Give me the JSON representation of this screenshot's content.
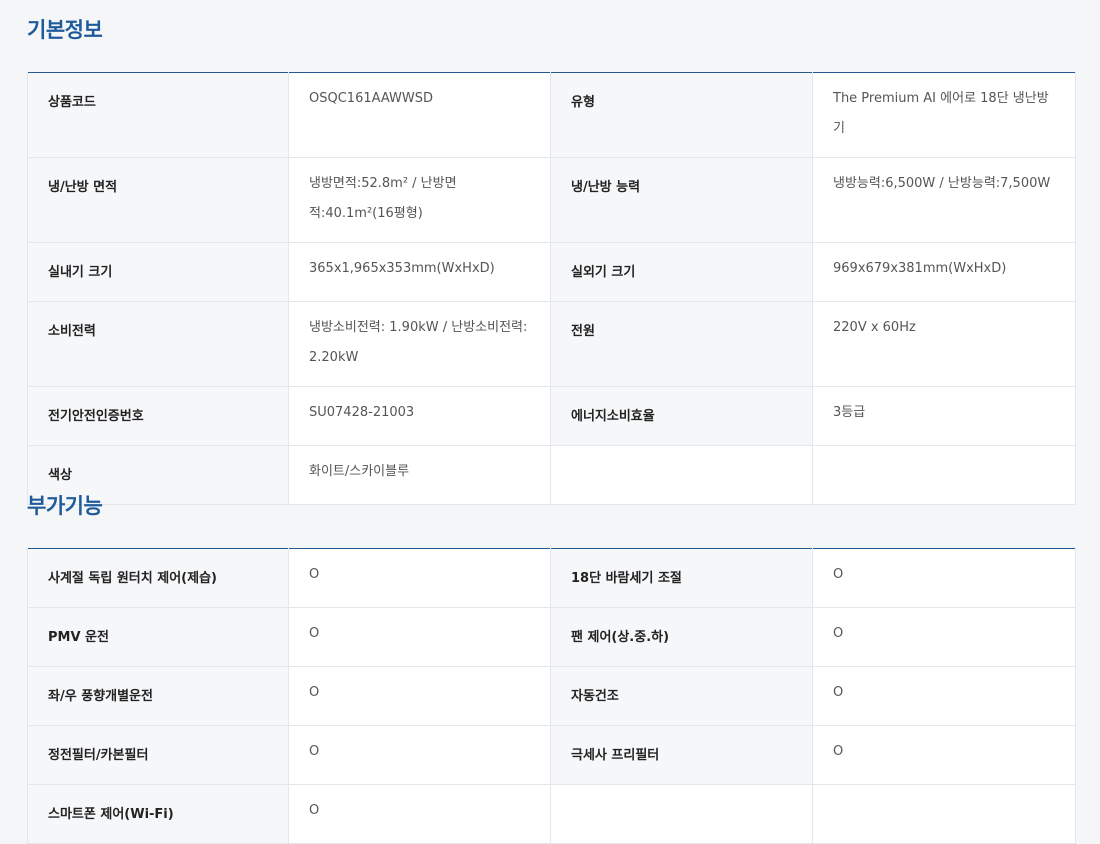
{
  "basic_info": {
    "title": "기본정보",
    "rows": [
      [
        {
          "label": "상품코드",
          "value": "OSQC161AAWWSD"
        },
        {
          "label": "유형",
          "value": "The Premium AI 에어로 18단 냉난방기"
        }
      ],
      [
        {
          "label": "냉/난방 면적",
          "value": "냉방면적:52.8m² / 난방면적:40.1m²(16평형)"
        },
        {
          "label": "냉/난방 능력",
          "value": "냉방능력:6,500W / 난방능력:7,500W"
        }
      ],
      [
        {
          "label": "실내기 크기",
          "value": "365x1,965x353mm(WxHxD)"
        },
        {
          "label": "실외기 크기",
          "value": "969x679x381mm(WxHxD)"
        }
      ],
      [
        {
          "label": "소비전력",
          "value": "냉방소비전력: 1.90kW / 난방소비전력: 2.20kW"
        },
        {
          "label": "전원",
          "value": "220V x 60Hz"
        }
      ],
      [
        {
          "label": "전기안전인증번호",
          "value": "SU07428-21003"
        },
        {
          "label": "에너지소비효율",
          "value": "3등급"
        }
      ],
      [
        {
          "label": "색상",
          "value": "화이트/스카이블루"
        },
        {
          "label": "",
          "value": ""
        }
      ]
    ]
  },
  "extra_features": {
    "title": "부가기능",
    "rows": [
      [
        {
          "label": "사계절 독립 원터치 제어(제습)",
          "value": "O"
        },
        {
          "label": "18단 바람세기 조절",
          "value": "O"
        }
      ],
      [
        {
          "label": "PMV 운전",
          "value": "O"
        },
        {
          "label": "팬 제어(상.중.하)",
          "value": "O"
        }
      ],
      [
        {
          "label": "좌/우 풍향개별운전",
          "value": "O"
        },
        {
          "label": "자동건조",
          "value": "O"
        }
      ],
      [
        {
          "label": "정전필터/카본필터",
          "value": "O"
        },
        {
          "label": "극세사 프리필터",
          "value": "O"
        }
      ],
      [
        {
          "label": "스마트폰 제어(Wi-Fi)",
          "value": "O"
        },
        {
          "label": "",
          "value": ""
        }
      ]
    ]
  },
  "colors": {
    "title": "#1f5b9b",
    "table_top_border": "#245a8d",
    "label_bg": "#f6f7f9",
    "page_bg": "#f4f6f8"
  }
}
